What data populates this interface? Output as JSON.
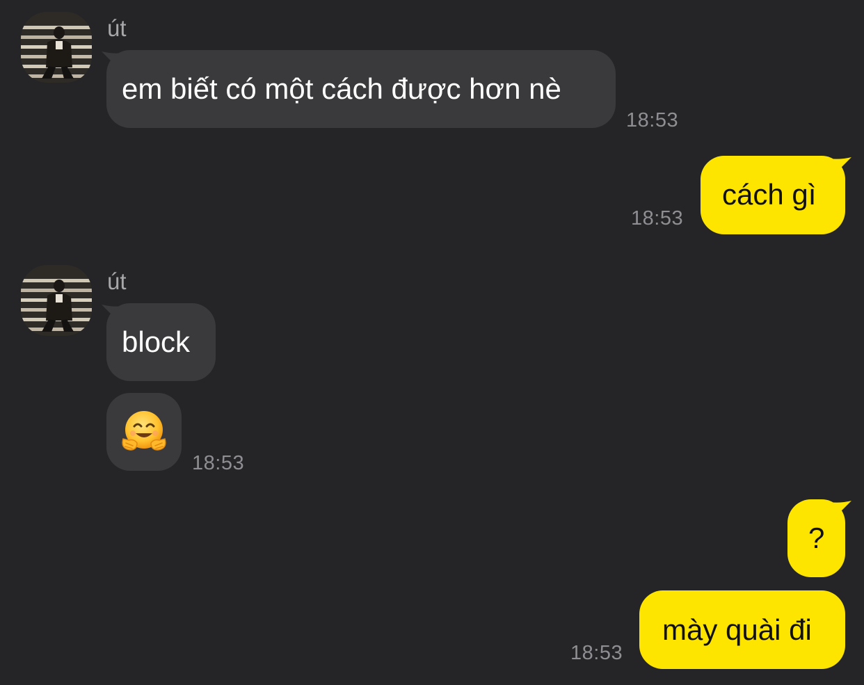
{
  "colors": {
    "background": "#252527",
    "incoming_bubble": "#3a3a3c",
    "outgoing_bubble": "#fee500",
    "sender_name": "#a7a7aa",
    "timestamp": "#8e8e93"
  },
  "messages": [
    {
      "group": 1,
      "direction": "incoming",
      "sender": "út",
      "avatar_icon": "profile-photo",
      "text": "em biết có một cách được hơn nè",
      "time": "18:53"
    },
    {
      "group": 2,
      "direction": "outgoing",
      "text": "cách gì",
      "time": "18:53"
    },
    {
      "group": 3,
      "direction": "incoming",
      "sender": "út",
      "avatar_icon": "profile-photo",
      "text": "block",
      "emoji_text": "🤗",
      "emoji_name": "hugging-face-emoji",
      "time": "18:53"
    },
    {
      "group": 4,
      "direction": "outgoing",
      "text": "?",
      "text2": "mày quài đi",
      "time": "18:53"
    }
  ]
}
